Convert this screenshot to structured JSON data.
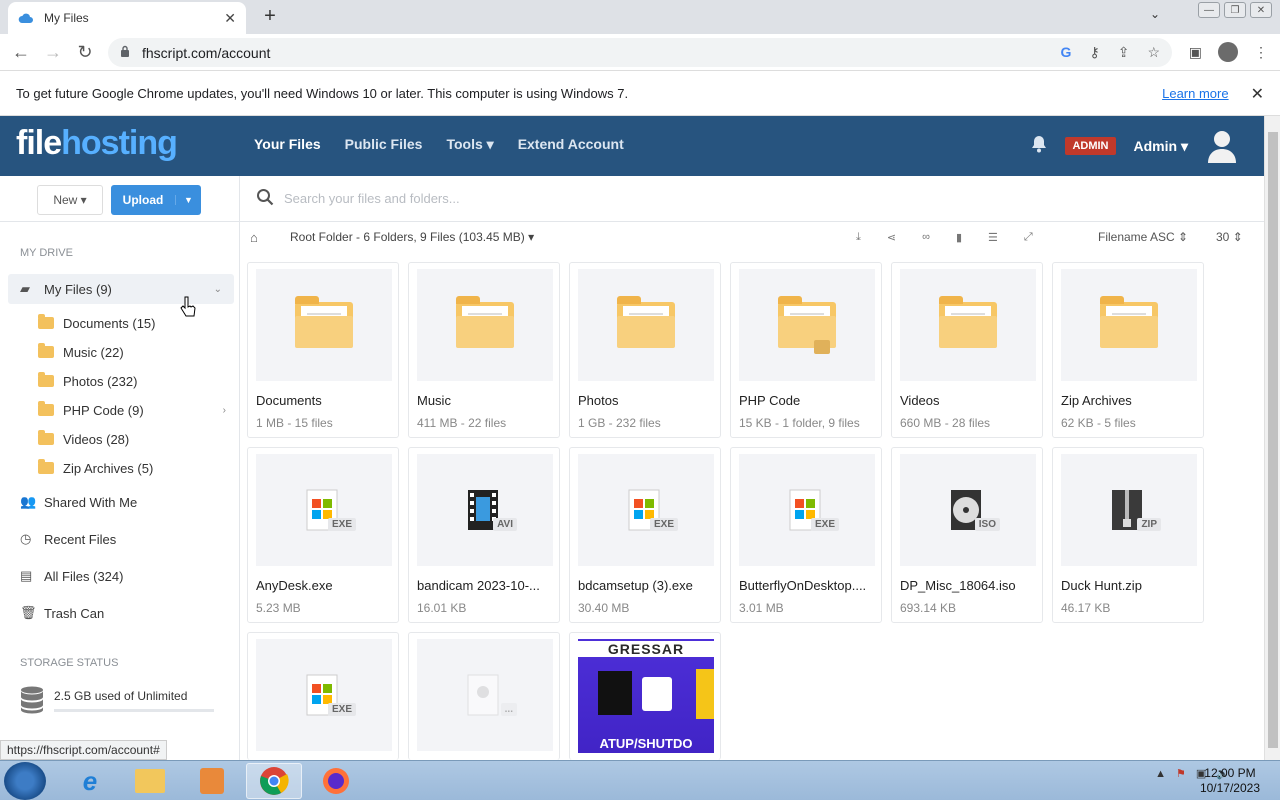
{
  "browser": {
    "tab_title": "My Files",
    "url": "fhscript.com/account",
    "status_url": "https://fhscript.com/account#"
  },
  "infobar": {
    "message": "To get future Google Chrome updates, you'll need Windows 10 or later. This computer is using Windows 7.",
    "link": "Learn more"
  },
  "header": {
    "logo_a": "file",
    "logo_b": "hosting",
    "nav": [
      "Your Files",
      "Public Files",
      "Tools",
      "Extend Account"
    ],
    "badge": "ADMIN",
    "user": "Admin"
  },
  "sidebar": {
    "new_label": "New",
    "upload_label": "Upload",
    "drive_heading": "MY DRIVE",
    "my_files": "My Files (9)",
    "folders": [
      "Documents (15)",
      "Music (22)",
      "Photos (232)",
      "PHP Code (9)",
      "Videos (28)",
      "Zip Archives (5)"
    ],
    "shared": "Shared With Me",
    "recent": "Recent Files",
    "all": "All Files (324)",
    "trash": "Trash Can",
    "storage_heading": "STORAGE STATUS",
    "storage_text": "2.5 GB used of Unlimited"
  },
  "main": {
    "search_placeholder": "Search your files and folders...",
    "breadcrumb": "Root Folder - 6 Folders, 9 Files (103.45 MB)",
    "sort": "Filename ASC",
    "per_page": "30",
    "folders": [
      {
        "name": "Documents",
        "meta": "1 MB - 15 files"
      },
      {
        "name": "Music",
        "meta": "411 MB - 22 files"
      },
      {
        "name": "Photos",
        "meta": "1 GB - 232 files"
      },
      {
        "name": "PHP Code",
        "meta": "15 KB - 1 folder, 9 files"
      },
      {
        "name": "Videos",
        "meta": "660 MB - 28 files"
      },
      {
        "name": "Zip Archives",
        "meta": "62 KB - 5 files"
      }
    ],
    "files": [
      {
        "name": "AnyDesk.exe",
        "meta": "5.23 MB",
        "ext": "EXE"
      },
      {
        "name": "bandicam 2023-10-...",
        "meta": "16.01 KB",
        "ext": "AVI"
      },
      {
        "name": "bdcamsetup (3).exe",
        "meta": "30.40 MB",
        "ext": "EXE"
      },
      {
        "name": "ButterflyOnDesktop....",
        "meta": "3.01 MB",
        "ext": "EXE"
      },
      {
        "name": "DP_Misc_18064.iso",
        "meta": "693.14 KB",
        "ext": "ISO"
      },
      {
        "name": "Duck Hunt.zip",
        "meta": "46.17 KB",
        "ext": "ZIP"
      }
    ],
    "row3": [
      {
        "ext": "EXE"
      },
      {
        "ext": "..."
      },
      {
        "promo_top": "GRESSAR",
        "promo_bottom": "ATUP/SHUTDO"
      }
    ]
  },
  "taskbar": {
    "time": "12:00 PM",
    "date": "10/17/2023"
  }
}
